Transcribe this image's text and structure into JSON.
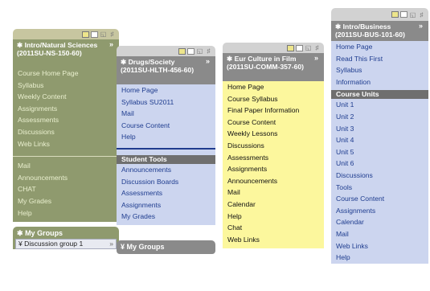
{
  "panels": [
    {
      "title": "Intro/Natural Sciences (2011SU-NS-150-60)",
      "links": [
        "Course Home Page",
        "Syllabus",
        "Weekly Content",
        "Assignments",
        "Assessments",
        "Discussions",
        "Web Links"
      ],
      "links2": [
        "Mail",
        "Announcements",
        "CHAT",
        "My Grades",
        "Help"
      ],
      "groups_title": "My Groups",
      "group_selected": "Discussion group 1"
    },
    {
      "title": "Drugs/Society (2011SU-HLTH-456-60)",
      "links": [
        "Home Page",
        "Syllabus SU2011",
        "Mail",
        "Course Content",
        "Help"
      ],
      "section": "Student Tools",
      "links2": [
        "Announcements",
        "Discussion Boards",
        "Assessments",
        "Assignments",
        "My Grades"
      ],
      "groups_title": "My Groups"
    },
    {
      "title": "Eur Culture in Film (2011SU-COMM-357-60)",
      "links": [
        "Home Page",
        "Course Syllabus",
        "Final Paper Information",
        "Course Content",
        "Weekly Lessons",
        "Discussions",
        "Assessments",
        "Assignments",
        "Announcements",
        "Mail",
        "Calendar",
        "Help",
        "Chat",
        "Web Links"
      ]
    },
    {
      "title": "Intro/Business (2011SU-BUS-101-60)",
      "links": [
        "Home Page",
        "Read This First",
        "Syllabus",
        "Information"
      ],
      "section": "Course Units",
      "links2": [
        "Unit 1",
        "Unit 2",
        "Unit 3",
        "Unit 4",
        "Unit 5",
        "Unit 6",
        "Discussions",
        "Tools",
        "Course Content",
        "Assignments",
        "Calendar",
        "Mail",
        "Web Links",
        "Help"
      ]
    }
  ],
  "icons": {
    "collapse_marker": "*",
    "expand_marker": "»",
    "group_dropdown": "¥"
  }
}
